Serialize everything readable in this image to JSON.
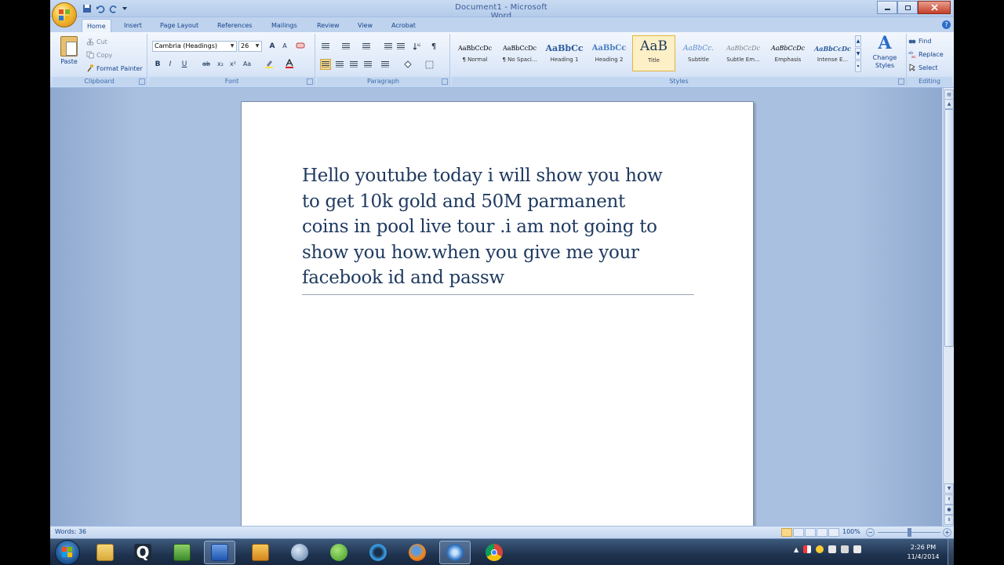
{
  "window": {
    "title": "Document1 - Microsoft Word"
  },
  "tabs": [
    "Home",
    "Insert",
    "Page Layout",
    "References",
    "Mailings",
    "Review",
    "View",
    "Acrobat"
  ],
  "clipboard": {
    "paste": "Paste",
    "cut": "Cut",
    "copy": "Copy",
    "format_painter": "Format Painter",
    "label": "Clipboard"
  },
  "font": {
    "name": "Cambria (Headings)",
    "size": "26",
    "label": "Font"
  },
  "paragraph": {
    "label": "Paragraph"
  },
  "styles": {
    "items": [
      {
        "sample": "AaBbCcDc",
        "name": "¶ Normal"
      },
      {
        "sample": "AaBbCcDc",
        "name": "¶ No Spaci..."
      },
      {
        "sample": "AaBbCc",
        "name": "Heading 1"
      },
      {
        "sample": "AaBbCc",
        "name": "Heading 2"
      },
      {
        "sample": "AaB",
        "name": "Title"
      },
      {
        "sample": "AaBbCc.",
        "name": "Subtitle"
      },
      {
        "sample": "AaBbCcDc",
        "name": "Subtle Em..."
      },
      {
        "sample": "AaBbCcDc",
        "name": "Emphasis"
      },
      {
        "sample": "AaBbCcDc",
        "name": "Intense E..."
      }
    ],
    "change_styles": "Change Styles",
    "label": "Styles"
  },
  "editing": {
    "find": "Find",
    "replace": "Replace",
    "select": "Select",
    "label": "Editing"
  },
  "document": {
    "lines": [
      "Hello youtube today i will show you how",
      "to get 10k gold and 50M parmanent",
      "coins in pool live tour .i am not going to",
      "show you how.when you give me your",
      "facebook id and passw"
    ]
  },
  "status": {
    "words": "Words: 36",
    "zoom": "100%"
  },
  "taskbar": {
    "time": "2:26 PM",
    "date": "11/4/2014"
  },
  "colors": {
    "ribbon": "#dbe7f8",
    "doc_background": "#aac0e0",
    "text": "#1f3a60",
    "accent": "#15428b"
  }
}
